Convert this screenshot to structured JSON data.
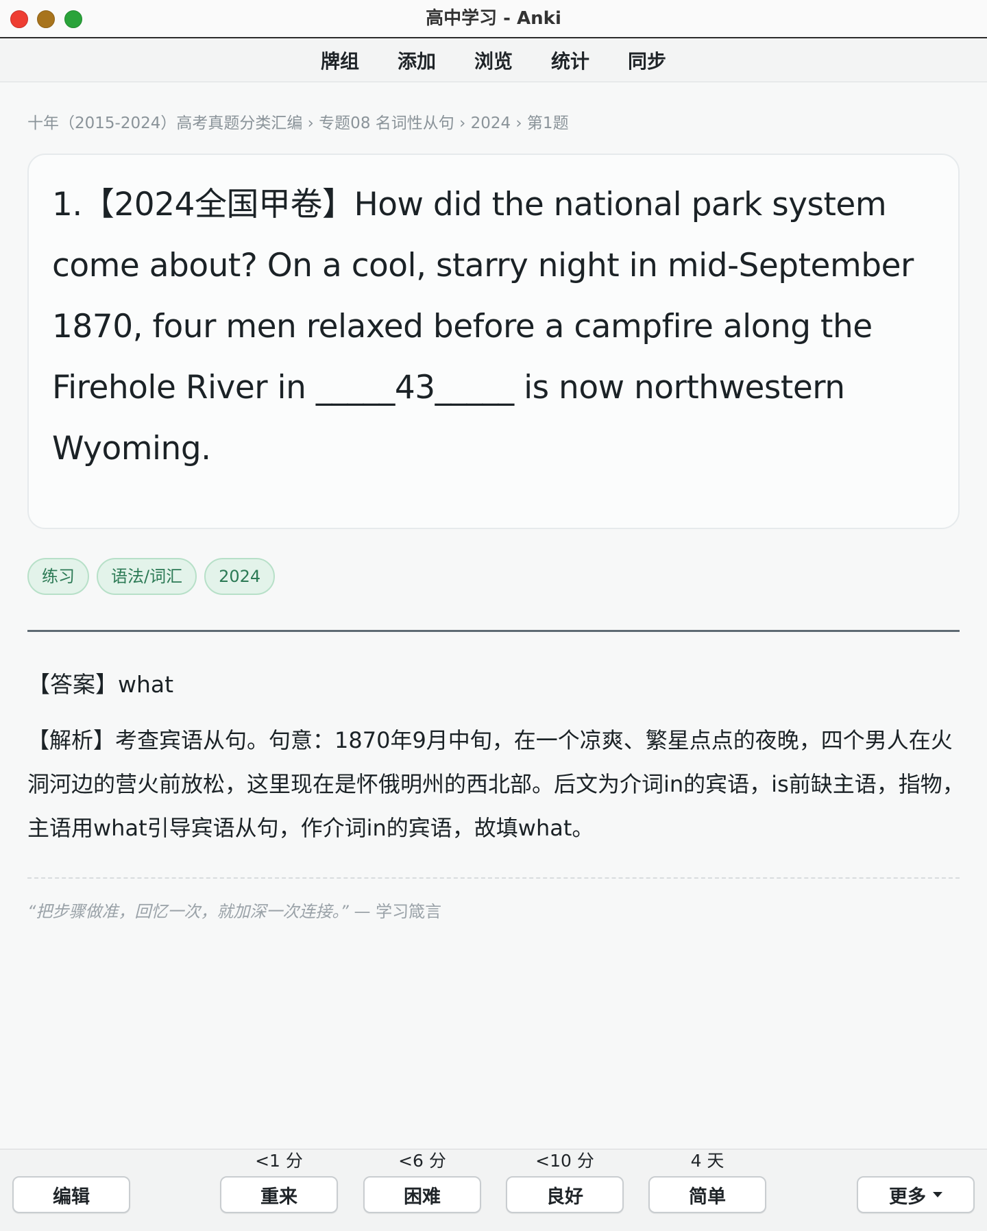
{
  "window": {
    "title": "高中学习 - Anki"
  },
  "menu": {
    "items": [
      "牌组",
      "添加",
      "浏览",
      "统计",
      "同步"
    ]
  },
  "breadcrumb": "十年（2015-2024）高考真题分类汇编 › 专题08 名词性从句 › 2024 › 第1题",
  "question": {
    "text": "1.【2024全国甲卷】How did the national park system come about? On a cool, starry night in mid-September 1870, four men relaxed before a campfire along the Firehole River in _____43_____ is now northwestern Wyoming."
  },
  "tags": [
    "练习",
    "语法/词汇",
    "2024"
  ],
  "answer": {
    "text": "【答案】what"
  },
  "analysis": {
    "text": "【解析】考查宾语从句。句意：1870年9月中旬，在一个凉爽、繁星点点的夜晚，四个男人在火洞河边的营火前放松，这里现在是怀俄明州的西北部。后文为介词in的宾语，is前缺主语，指物，主语用what引导宾语从句，作介词in的宾语，故填what。"
  },
  "quote": {
    "text": "“把步骤做准，回忆一次，就加深一次连接。”",
    "source": "— 学习箴言"
  },
  "bottom": {
    "edit_label": "编辑",
    "more_label": "更多",
    "answers": [
      {
        "interval": "<1 分",
        "label": "重来"
      },
      {
        "interval": "<6 分",
        "label": "困难"
      },
      {
        "interval": "<10 分",
        "label": "良好"
      },
      {
        "interval": "4 天",
        "label": "简单"
      }
    ]
  },
  "colors": {
    "close": "#ee3d32",
    "minimize": "#a8741d",
    "maximize": "#2aa33a",
    "tag_bg": "#e3f3ea",
    "tag_text": "#2c7a55"
  }
}
